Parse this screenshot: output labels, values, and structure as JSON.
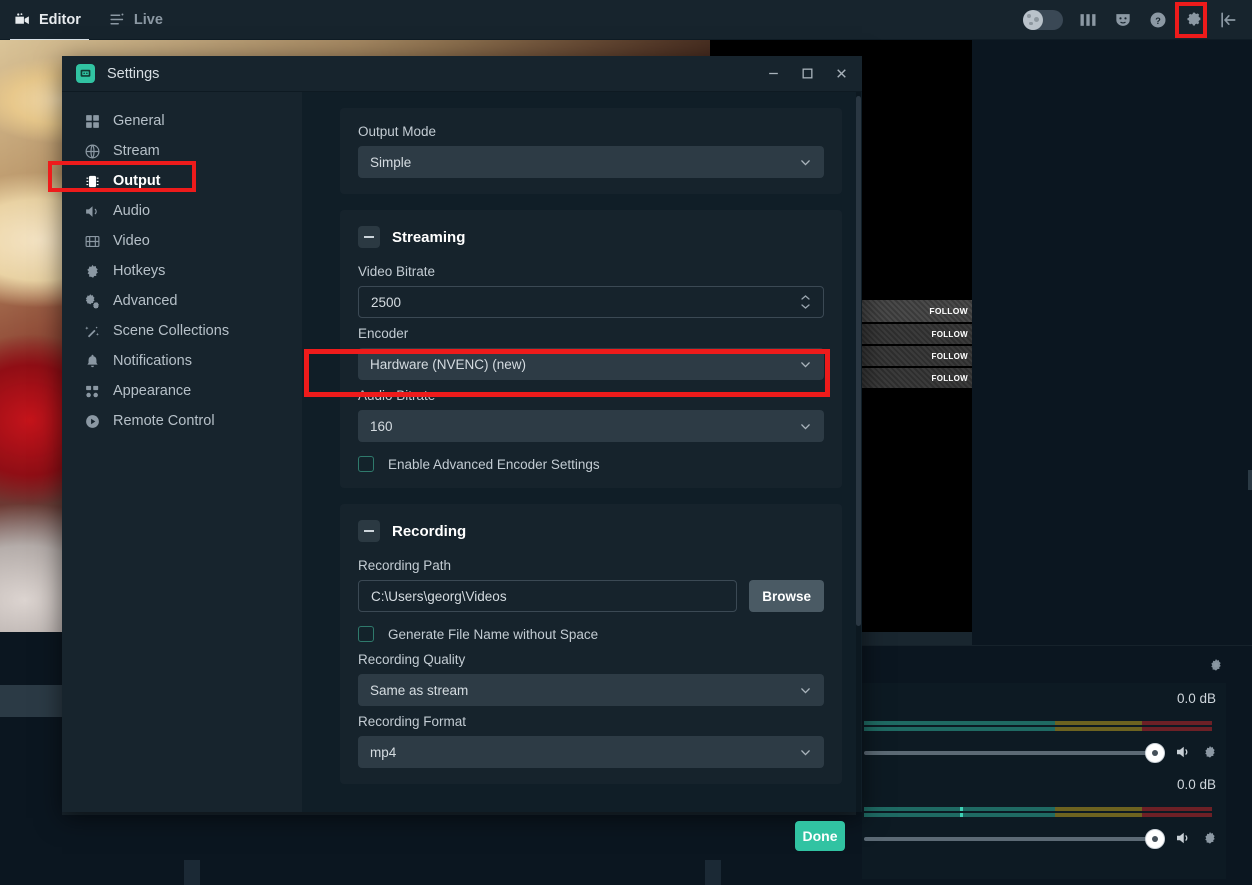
{
  "topnav": {
    "tabs": [
      {
        "label": "Editor",
        "icon": "camera-icon",
        "active": true
      },
      {
        "label": "Live",
        "icon": "sliders-icon",
        "active": false
      }
    ],
    "right_icons": [
      "moon-toggle",
      "columns-icon",
      "theater-masks-icon",
      "help-icon",
      "gear-icon",
      "collapse-icon"
    ],
    "gear_highlighted": true,
    "highlight_color": "#ee1b1b"
  },
  "preview": {
    "follow_alerts": [
      "FOLLOW",
      "FOLLOW",
      "FOLLOW",
      "FOLLOW"
    ]
  },
  "mixer": {
    "channels": [
      {
        "db": "0.0 dB"
      },
      {
        "db": "0.0 dB"
      }
    ]
  },
  "modal": {
    "title": "Settings",
    "logo_icon": "streamlabs-logo-icon",
    "window_buttons": [
      "minimize-icon",
      "maximize-icon",
      "close-icon"
    ],
    "sidebar": [
      {
        "label": "General",
        "icon": "grid-icon",
        "active": false
      },
      {
        "label": "Stream",
        "icon": "globe-icon",
        "active": false
      },
      {
        "label": "Output",
        "icon": "chip-icon",
        "active": true
      },
      {
        "label": "Audio",
        "icon": "speaker-icon",
        "active": false
      },
      {
        "label": "Video",
        "icon": "film-icon",
        "active": false
      },
      {
        "label": "Hotkeys",
        "icon": "gear-icon",
        "active": false
      },
      {
        "label": "Advanced",
        "icon": "gears-icon",
        "active": false
      },
      {
        "label": "Scene Collections",
        "icon": "wand-icon",
        "active": false
      },
      {
        "label": "Notifications",
        "icon": "bell-icon",
        "active": false
      },
      {
        "label": "Appearance",
        "icon": "dots-icon",
        "active": false
      },
      {
        "label": "Remote Control",
        "icon": "play-circle-icon",
        "active": false
      }
    ],
    "output_mode": {
      "label": "Output Mode",
      "value": "Simple"
    },
    "streaming": {
      "section_title": "Streaming",
      "video_bitrate_label": "Video Bitrate",
      "video_bitrate_value": "2500",
      "encoder_label": "Encoder",
      "encoder_value": "Hardware (NVENC) (new)",
      "encoder_highlighted": true,
      "audio_bitrate_label": "Audio Bitrate",
      "audio_bitrate_value": "160",
      "advanced_checkbox_label": "Enable Advanced Encoder Settings",
      "advanced_checkbox_checked": false
    },
    "recording": {
      "section_title": "Recording",
      "path_label": "Recording Path",
      "path_value": "C:\\Users\\georg\\Videos",
      "browse_label": "Browse",
      "nospace_checkbox_label": "Generate File Name without Space",
      "nospace_checkbox_checked": false,
      "quality_label": "Recording Quality",
      "quality_value": "Same as stream",
      "format_label": "Recording Format",
      "format_value": "mp4"
    },
    "done_label": "Done",
    "done_color": "#31c3a2"
  }
}
